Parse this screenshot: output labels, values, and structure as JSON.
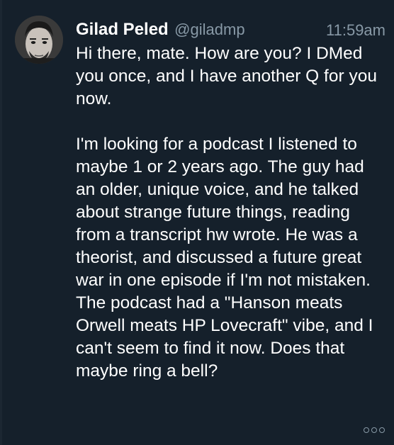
{
  "tweet": {
    "author": {
      "display_name": "Gilad Peled",
      "handle": "@giladmp"
    },
    "timestamp": "11:59am",
    "text": "Hi there, mate. How are you? I DMed you once, and I have another Q for you now.\n\nI'm looking for a podcast I listened to maybe 1 or 2 years ago. The guy had an older, unique voice, and he talked about strange future things, reading from a transcript hw wrote. He was a theorist, and discussed a future great war in one episode if I'm not mistaken. The podcast had a \"Hanson meats Orwell meats HP Lovecraft\" vibe, and I can't seem to find it now. Does that maybe ring a bell?"
  },
  "icons": {
    "avatar": "avatar-photo",
    "more": "more-options-icon"
  },
  "colors": {
    "background": "#15202b",
    "primary_text": "#ffffff",
    "secondary_text": "#8899a6"
  }
}
